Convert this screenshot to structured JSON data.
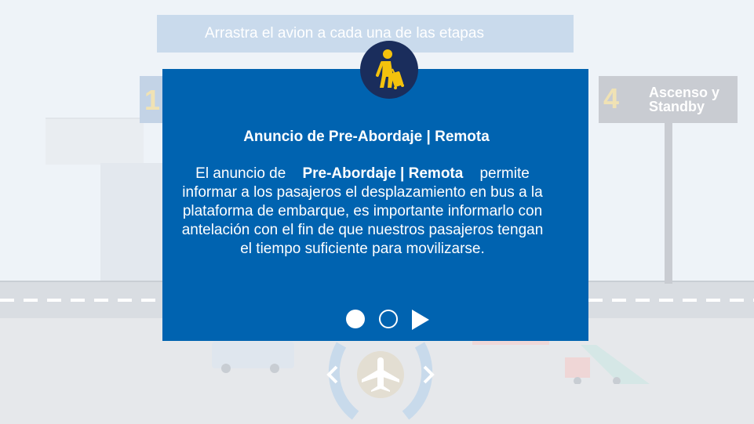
{
  "instruction": "Arrastra el avion a cada una de las etapas",
  "stages": {
    "left": {
      "number": "1"
    },
    "right": {
      "number": "4",
      "label": "Ascenso y Standby"
    }
  },
  "modal": {
    "icon": "passenger-with-luggage-icon",
    "title": "Anuncio de Pre-Abordaje | Remota",
    "body_prefix": "El anuncio de",
    "body_highlight": "Pre-Abordaje | Remota",
    "body_suffix": "permite informar a los pasajeros el desplazamiento en bus a la plataforma de embarque, es importante informarlo con antelación con el fin de que nuestros pasajeros tengan el tiempo suficiente para movilizarse.",
    "pager": {
      "total": 2,
      "current": 1
    }
  },
  "carousel": {
    "prev_icon": "chevron-left-icon",
    "center_icon": "airplane-icon",
    "next_icon": "chevron-right-icon"
  },
  "colors": {
    "modal_bg": "#0063b0",
    "icon_circle": "#1a2d5c",
    "icon_accent": "#f4c20d",
    "stage_number": "#f0e2b4"
  }
}
